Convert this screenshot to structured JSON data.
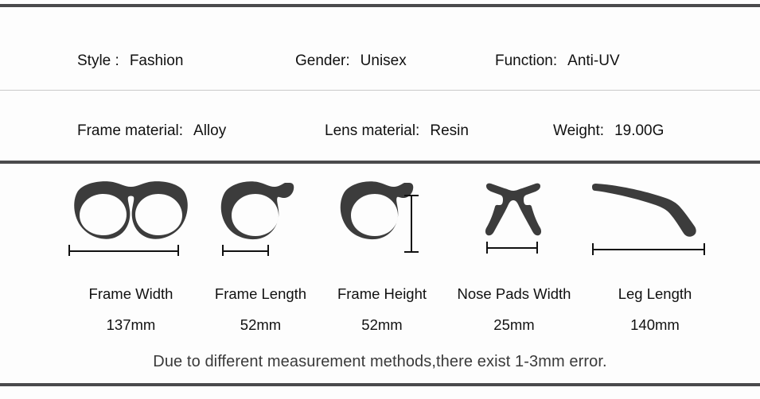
{
  "colors": {
    "background": "#fdfdfd",
    "rule_dark": "#4a4a4c",
    "rule_light": "#c9c9c9",
    "icon_fill": "#3c3c3c",
    "text": "#111111",
    "footer_text": "#3a3a3a"
  },
  "spec_rows": [
    {
      "items": [
        {
          "label": "Style :",
          "value": "Fashion"
        },
        {
          "label": "Gender:",
          "value": "Unisex"
        },
        {
          "label": "Function:",
          "value": "Anti-UV"
        }
      ]
    },
    {
      "items": [
        {
          "label": "Frame material:",
          "value": "Alloy"
        },
        {
          "label": "Lens material:",
          "value": "Resin"
        },
        {
          "label": "Weight:",
          "value": "19.00G"
        }
      ]
    }
  ],
  "measurements": [
    {
      "icon": "eyeglasses-front-icon",
      "label": "Frame Width",
      "value": "137mm",
      "bar": "horizontal"
    },
    {
      "icon": "single-lens-rim-icon",
      "label": "Frame Length",
      "value": "52mm",
      "bar": "horizontal"
    },
    {
      "icon": "lens-rim-height-icon",
      "label": "Frame Height",
      "value": "52mm",
      "bar": "vertical"
    },
    {
      "icon": "nose-pads-icon",
      "label": "Nose Pads Width",
      "value": "25mm",
      "bar": "horizontal"
    },
    {
      "icon": "temple-arm-icon",
      "label": "Leg Length",
      "value": "140mm",
      "bar": "horizontal"
    }
  ],
  "footer": {
    "note": "Due to different measurement methods,there exist 1-3mm error."
  }
}
